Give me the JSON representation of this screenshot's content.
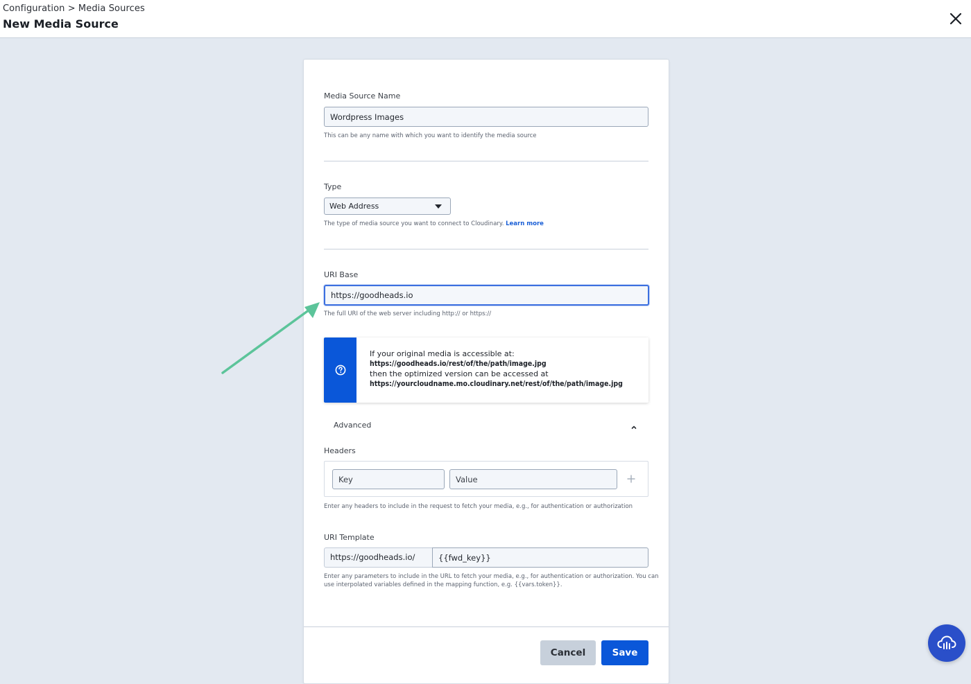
{
  "header": {
    "breadcrumb": "Configuration > Media Sources",
    "title": "New Media Source"
  },
  "form": {
    "name": {
      "label": "Media Source Name",
      "value": "Wordpress Images",
      "help": "This can be any name with which you want to identify the media source"
    },
    "type": {
      "label": "Type",
      "selected": "Web Address",
      "help": "The type of media source you want to connect to Cloudinary.",
      "learn_more": "Learn more"
    },
    "uri_base": {
      "label": "URI Base",
      "value": "https://goodheads.io",
      "help": "The full URI of the web server including http:// or https://"
    },
    "info": {
      "line1": "If your original media is accessible at:",
      "line2": "https://goodheads.io/rest/of/the/path/image.jpg",
      "line3": "then the optimized version can be accessed at",
      "line4": "https://yourcloudname.mo.cloudinary.net/rest/of/the/path/image.jpg"
    },
    "advanced": {
      "label": "Advanced"
    },
    "headers": {
      "label": "Headers",
      "key_placeholder": "Key",
      "value_placeholder": "Value",
      "help": "Enter any headers to include in the request to fetch your media, e.g., for authentication or authorization"
    },
    "uri_template": {
      "label": "URI Template",
      "prefix": "https://goodheads.io/",
      "value": "{{fwd_key}}",
      "help_line1": "Enter any parameters to include in the URL to fetch your media, e.g., for authentication or authorization. You can",
      "help_line2": "use interpolated variables defined in the mapping function, e.g. {{vars.token}}."
    }
  },
  "footer": {
    "cancel_label": "Cancel",
    "save_label": "Save"
  },
  "colors": {
    "primary": "#0a57d9",
    "annotation_arrow": "#5cc49a",
    "background": "#e3e9f1"
  }
}
